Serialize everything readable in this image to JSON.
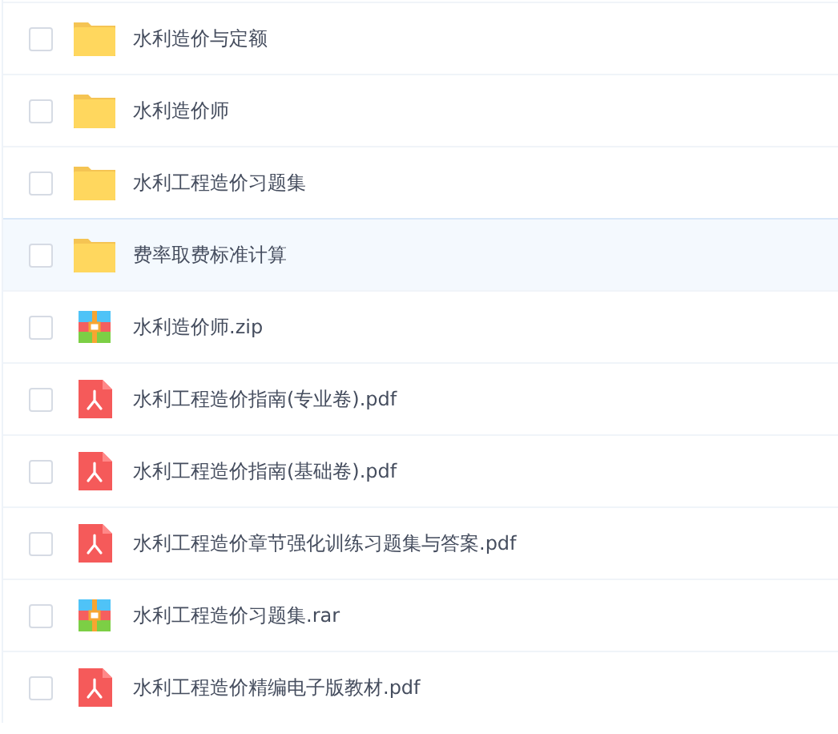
{
  "files": [
    {
      "kind": "folder",
      "name": "水利造价与定额",
      "checked": false,
      "selected": false
    },
    {
      "kind": "folder",
      "name": "水利造价师",
      "checked": false,
      "selected": false
    },
    {
      "kind": "folder",
      "name": "水利工程造价习题集",
      "checked": false,
      "selected": false
    },
    {
      "kind": "folder",
      "name": "费率取费标准计算",
      "checked": false,
      "selected": true
    },
    {
      "kind": "archive",
      "name": "水利造价师.zip",
      "checked": false,
      "selected": false
    },
    {
      "kind": "pdf",
      "name": "水利工程造价指南(专业卷).pdf",
      "checked": false,
      "selected": false
    },
    {
      "kind": "pdf",
      "name": "水利工程造价指南(基础卷).pdf",
      "checked": false,
      "selected": false
    },
    {
      "kind": "pdf",
      "name": "水利工程造价章节强化训练习题集与答案.pdf",
      "checked": false,
      "selected": false
    },
    {
      "kind": "archive",
      "name": "水利工程造价习题集.rar",
      "checked": false,
      "selected": false
    },
    {
      "kind": "pdf",
      "name": "水利工程造价精编电子版教材.pdf",
      "checked": false,
      "selected": false
    }
  ]
}
